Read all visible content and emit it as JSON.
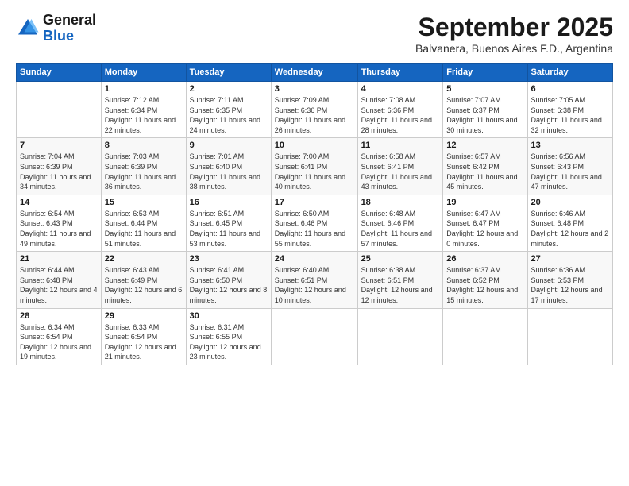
{
  "logo": {
    "line1": "General",
    "line2": "Blue"
  },
  "header": {
    "month": "September 2025",
    "location": "Balvanera, Buenos Aires F.D., Argentina"
  },
  "days_of_week": [
    "Sunday",
    "Monday",
    "Tuesday",
    "Wednesday",
    "Thursday",
    "Friday",
    "Saturday"
  ],
  "weeks": [
    [
      {
        "day": "",
        "info": ""
      },
      {
        "day": "1",
        "info": "Sunrise: 7:12 AM\nSunset: 6:34 PM\nDaylight: 11 hours\nand 22 minutes."
      },
      {
        "day": "2",
        "info": "Sunrise: 7:11 AM\nSunset: 6:35 PM\nDaylight: 11 hours\nand 24 minutes."
      },
      {
        "day": "3",
        "info": "Sunrise: 7:09 AM\nSunset: 6:36 PM\nDaylight: 11 hours\nand 26 minutes."
      },
      {
        "day": "4",
        "info": "Sunrise: 7:08 AM\nSunset: 6:36 PM\nDaylight: 11 hours\nand 28 minutes."
      },
      {
        "day": "5",
        "info": "Sunrise: 7:07 AM\nSunset: 6:37 PM\nDaylight: 11 hours\nand 30 minutes."
      },
      {
        "day": "6",
        "info": "Sunrise: 7:05 AM\nSunset: 6:38 PM\nDaylight: 11 hours\nand 32 minutes."
      }
    ],
    [
      {
        "day": "7",
        "info": "Sunrise: 7:04 AM\nSunset: 6:39 PM\nDaylight: 11 hours\nand 34 minutes."
      },
      {
        "day": "8",
        "info": "Sunrise: 7:03 AM\nSunset: 6:39 PM\nDaylight: 11 hours\nand 36 minutes."
      },
      {
        "day": "9",
        "info": "Sunrise: 7:01 AM\nSunset: 6:40 PM\nDaylight: 11 hours\nand 38 minutes."
      },
      {
        "day": "10",
        "info": "Sunrise: 7:00 AM\nSunset: 6:41 PM\nDaylight: 11 hours\nand 40 minutes."
      },
      {
        "day": "11",
        "info": "Sunrise: 6:58 AM\nSunset: 6:41 PM\nDaylight: 11 hours\nand 43 minutes."
      },
      {
        "day": "12",
        "info": "Sunrise: 6:57 AM\nSunset: 6:42 PM\nDaylight: 11 hours\nand 45 minutes."
      },
      {
        "day": "13",
        "info": "Sunrise: 6:56 AM\nSunset: 6:43 PM\nDaylight: 11 hours\nand 47 minutes."
      }
    ],
    [
      {
        "day": "14",
        "info": "Sunrise: 6:54 AM\nSunset: 6:43 PM\nDaylight: 11 hours\nand 49 minutes."
      },
      {
        "day": "15",
        "info": "Sunrise: 6:53 AM\nSunset: 6:44 PM\nDaylight: 11 hours\nand 51 minutes."
      },
      {
        "day": "16",
        "info": "Sunrise: 6:51 AM\nSunset: 6:45 PM\nDaylight: 11 hours\nand 53 minutes."
      },
      {
        "day": "17",
        "info": "Sunrise: 6:50 AM\nSunset: 6:46 PM\nDaylight: 11 hours\nand 55 minutes."
      },
      {
        "day": "18",
        "info": "Sunrise: 6:48 AM\nSunset: 6:46 PM\nDaylight: 11 hours\nand 57 minutes."
      },
      {
        "day": "19",
        "info": "Sunrise: 6:47 AM\nSunset: 6:47 PM\nDaylight: 12 hours\nand 0 minutes."
      },
      {
        "day": "20",
        "info": "Sunrise: 6:46 AM\nSunset: 6:48 PM\nDaylight: 12 hours\nand 2 minutes."
      }
    ],
    [
      {
        "day": "21",
        "info": "Sunrise: 6:44 AM\nSunset: 6:48 PM\nDaylight: 12 hours\nand 4 minutes."
      },
      {
        "day": "22",
        "info": "Sunrise: 6:43 AM\nSunset: 6:49 PM\nDaylight: 12 hours\nand 6 minutes."
      },
      {
        "day": "23",
        "info": "Sunrise: 6:41 AM\nSunset: 6:50 PM\nDaylight: 12 hours\nand 8 minutes."
      },
      {
        "day": "24",
        "info": "Sunrise: 6:40 AM\nSunset: 6:51 PM\nDaylight: 12 hours\nand 10 minutes."
      },
      {
        "day": "25",
        "info": "Sunrise: 6:38 AM\nSunset: 6:51 PM\nDaylight: 12 hours\nand 12 minutes."
      },
      {
        "day": "26",
        "info": "Sunrise: 6:37 AM\nSunset: 6:52 PM\nDaylight: 12 hours\nand 15 minutes."
      },
      {
        "day": "27",
        "info": "Sunrise: 6:36 AM\nSunset: 6:53 PM\nDaylight: 12 hours\nand 17 minutes."
      }
    ],
    [
      {
        "day": "28",
        "info": "Sunrise: 6:34 AM\nSunset: 6:54 PM\nDaylight: 12 hours\nand 19 minutes."
      },
      {
        "day": "29",
        "info": "Sunrise: 6:33 AM\nSunset: 6:54 PM\nDaylight: 12 hours\nand 21 minutes."
      },
      {
        "day": "30",
        "info": "Sunrise: 6:31 AM\nSunset: 6:55 PM\nDaylight: 12 hours\nand 23 minutes."
      },
      {
        "day": "",
        "info": ""
      },
      {
        "day": "",
        "info": ""
      },
      {
        "day": "",
        "info": ""
      },
      {
        "day": "",
        "info": ""
      }
    ]
  ]
}
